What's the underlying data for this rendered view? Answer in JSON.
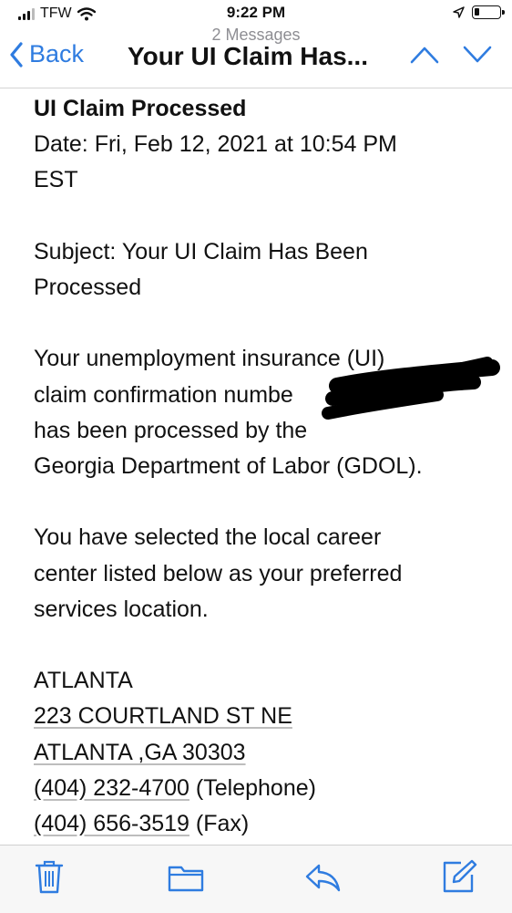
{
  "status_bar": {
    "carrier": "TFW",
    "time": "9:22 PM"
  },
  "nav": {
    "back_label": "Back",
    "subtitle": "2 Messages",
    "title": "Your UI Claim Has..."
  },
  "email": {
    "heading": "UI Claim Processed",
    "date_line": "Date: Fri, Feb 12, 2021 at 10:54 PM",
    "date_line_2": "EST",
    "subject_line": "Subject: Your UI Claim Has Been",
    "subject_line_2": "Processed",
    "body_line_1": "Your unemployment insurance (UI)",
    "body_line_2": "claim confirmation numbe",
    "body_line_3": "has been processed by the",
    "body_line_4": "Georgia Department of Labor (GDOL).",
    "career_line_1": "You have selected the local career",
    "career_line_2": "center listed below as your preferred",
    "career_line_3": "services location.",
    "office_city": "ATLANTA",
    "office_address_1": "223 COURTLAND ST NE",
    "office_address_2": "ATLANTA ,GA 30303",
    "phone": "(404) 232-4700",
    "phone_suffix": " (Telephone)",
    "fax": "(404) 656-3519",
    "fax_suffix": " (Fax)"
  },
  "toolbar": {
    "icons": [
      "trash-icon",
      "folder-icon",
      "reply-icon",
      "compose-icon"
    ],
    "accent": "#2f7ce0"
  },
  "colors": {
    "accent": "#2f7ce0",
    "text": "#111111"
  }
}
